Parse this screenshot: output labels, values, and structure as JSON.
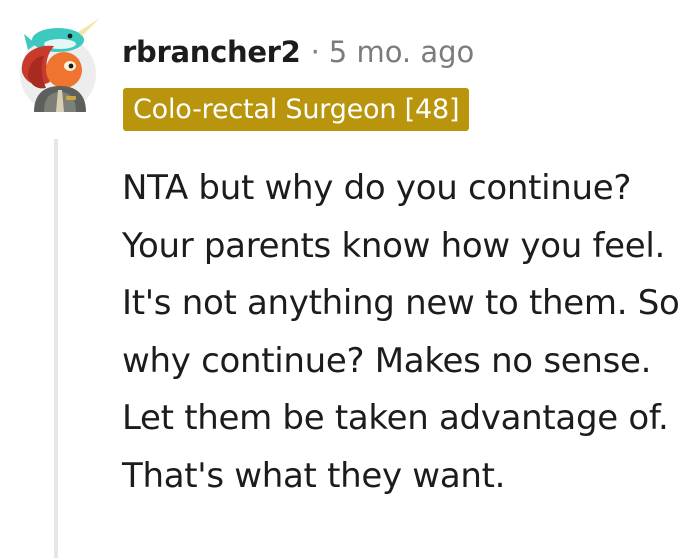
{
  "comment": {
    "username": "rbrancher2",
    "separator": "·",
    "timestamp": "5 mo. ago",
    "flair": "Colo-rectal Surgeon [48]",
    "body": "NTA but why do you continue? Your parents know how you feel. It's not anything new to them. So why continue? Makes no sense. Let them be taken advantage of. That's what they want."
  },
  "colors": {
    "flair_background": "#b8950c",
    "flair_text": "#ffffff",
    "username": "#1c1c1c",
    "timestamp": "#7c7c7c",
    "thread_line": "#e6e6e6"
  },
  "icons": {
    "avatar": "user-avatar-icon"
  }
}
